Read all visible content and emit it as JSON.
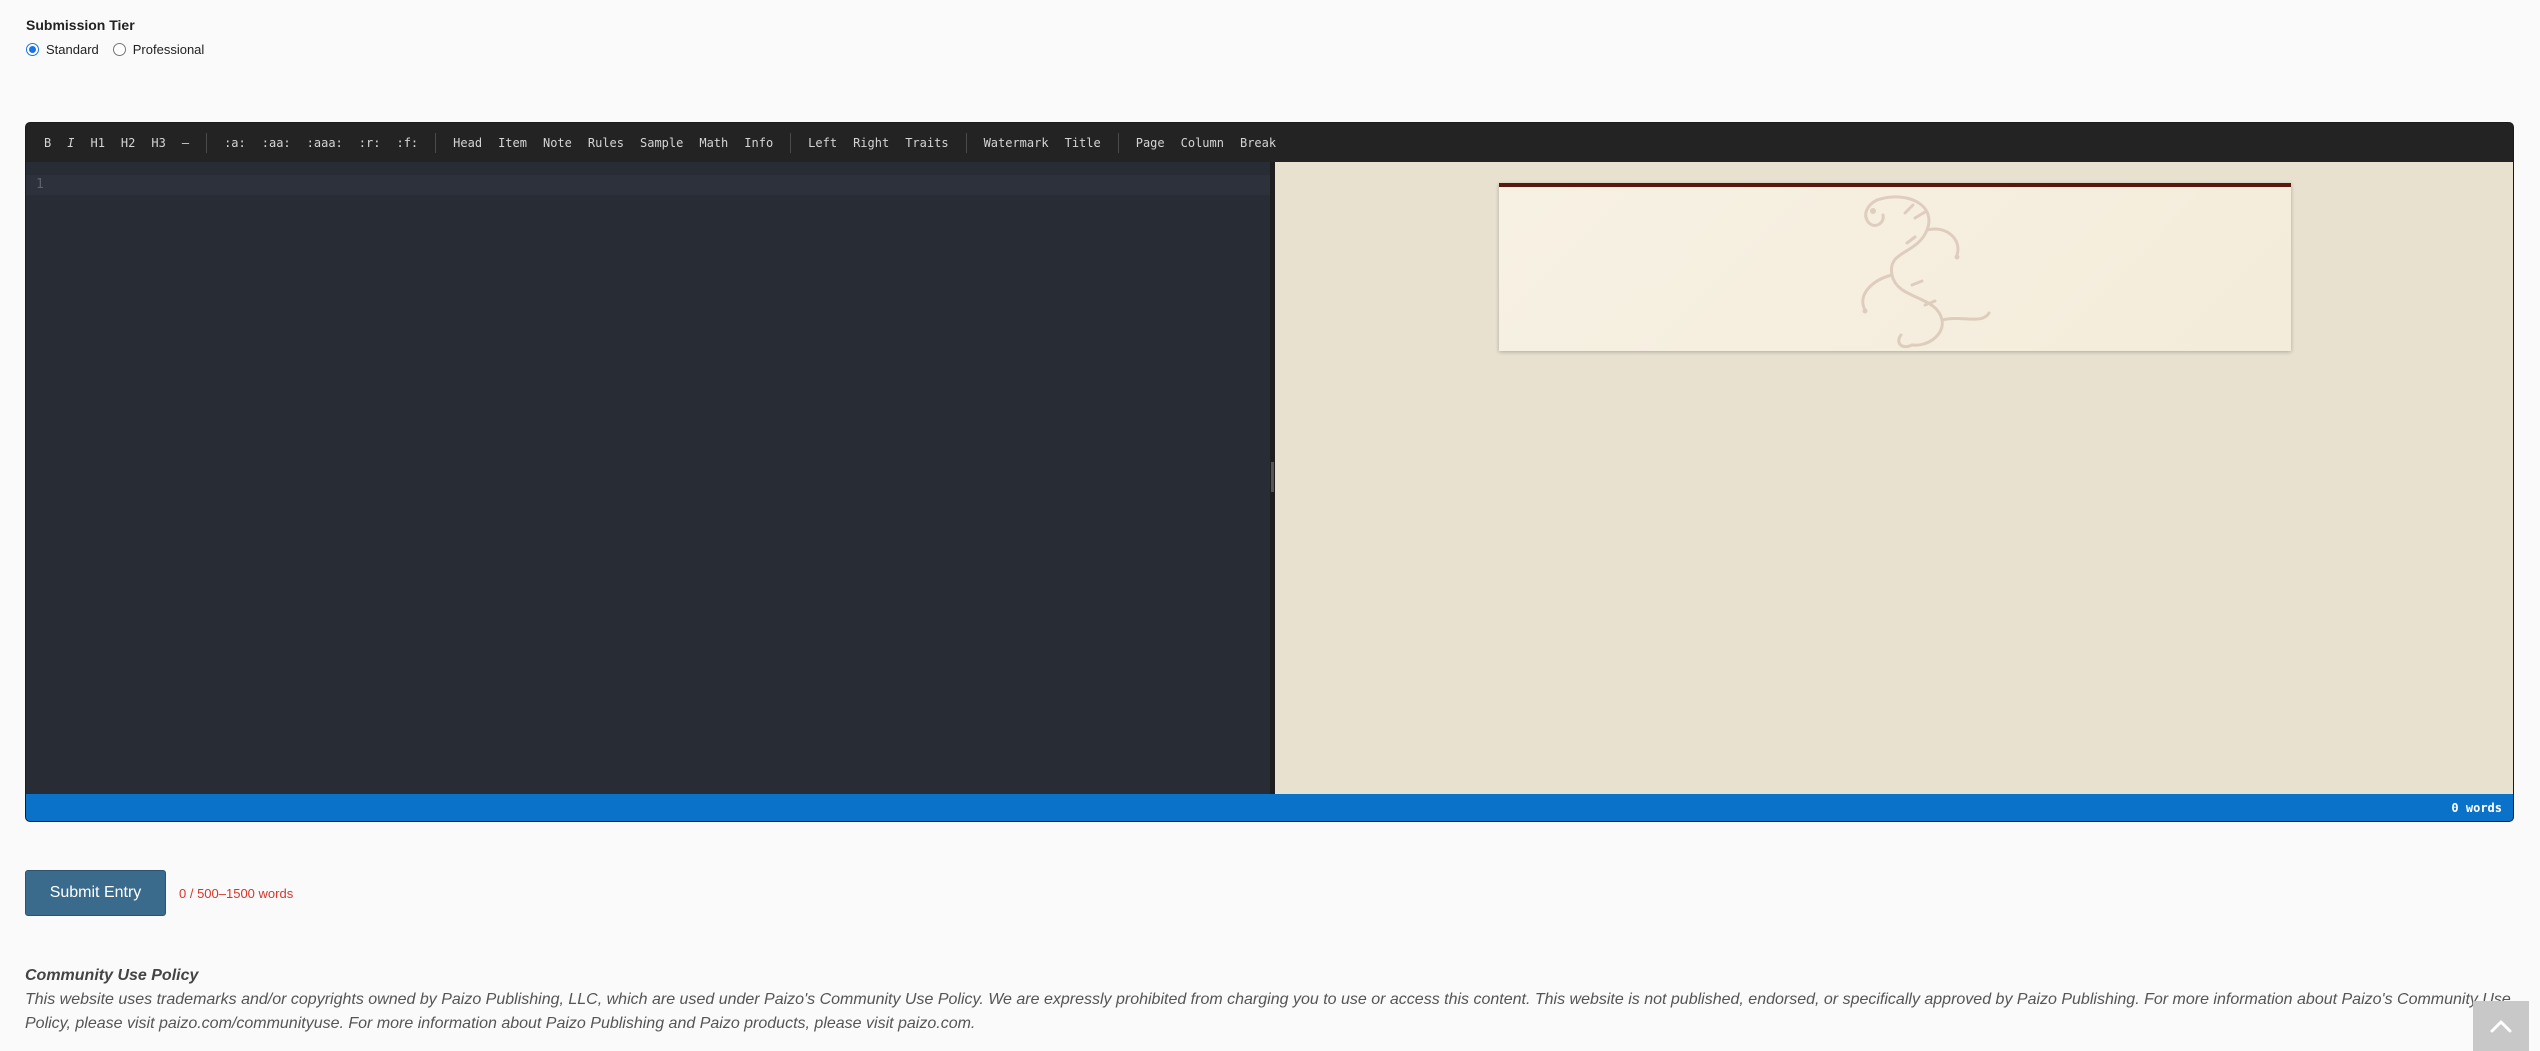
{
  "tier": {
    "title": "Submission Tier",
    "options": [
      {
        "label": "Standard",
        "checked": true
      },
      {
        "label": "Professional",
        "checked": false
      }
    ]
  },
  "toolbar": {
    "groups": [
      [
        "B",
        "I",
        "H1",
        "H2",
        "H3",
        "—"
      ],
      [
        ":a:",
        ":aa:",
        ":aaa:",
        ":r:",
        ":f:"
      ],
      [
        "Head",
        "Item",
        "Note",
        "Rules",
        "Sample",
        "Math",
        "Info"
      ],
      [
        "Left",
        "Right",
        "Traits"
      ],
      [
        "Watermark",
        "Title"
      ],
      [
        "Page",
        "Column",
        "Break"
      ]
    ]
  },
  "editor": {
    "line_numbers": [
      "1"
    ]
  },
  "status": {
    "word_count": "0 words"
  },
  "submit": {
    "label": "Submit Entry",
    "requirement": "0 / 500–1500 words"
  },
  "policy": {
    "title": "Community Use Policy",
    "text": "This website uses trademarks and/or copyrights owned by Paizo Publishing, LLC, which are used under Paizo's Community Use Policy. We are expressly prohibited from charging you to use or access this content. This website is not published, endorsed, or specifically approved by Paizo Publishing. For more information about Paizo's Community Use Policy, please visit paizo.com/communityuse. For more information about Paizo Publishing and Paizo products, please visit paizo.com."
  },
  "colors": {
    "accent": "#0a72c9",
    "submit_button": "#3a6b8c",
    "warning_text": "#d9342b",
    "page_rule": "#58180d"
  },
  "icons": {
    "scroll_top": "chevron-up-icon",
    "watermark": "dragon-icon"
  }
}
